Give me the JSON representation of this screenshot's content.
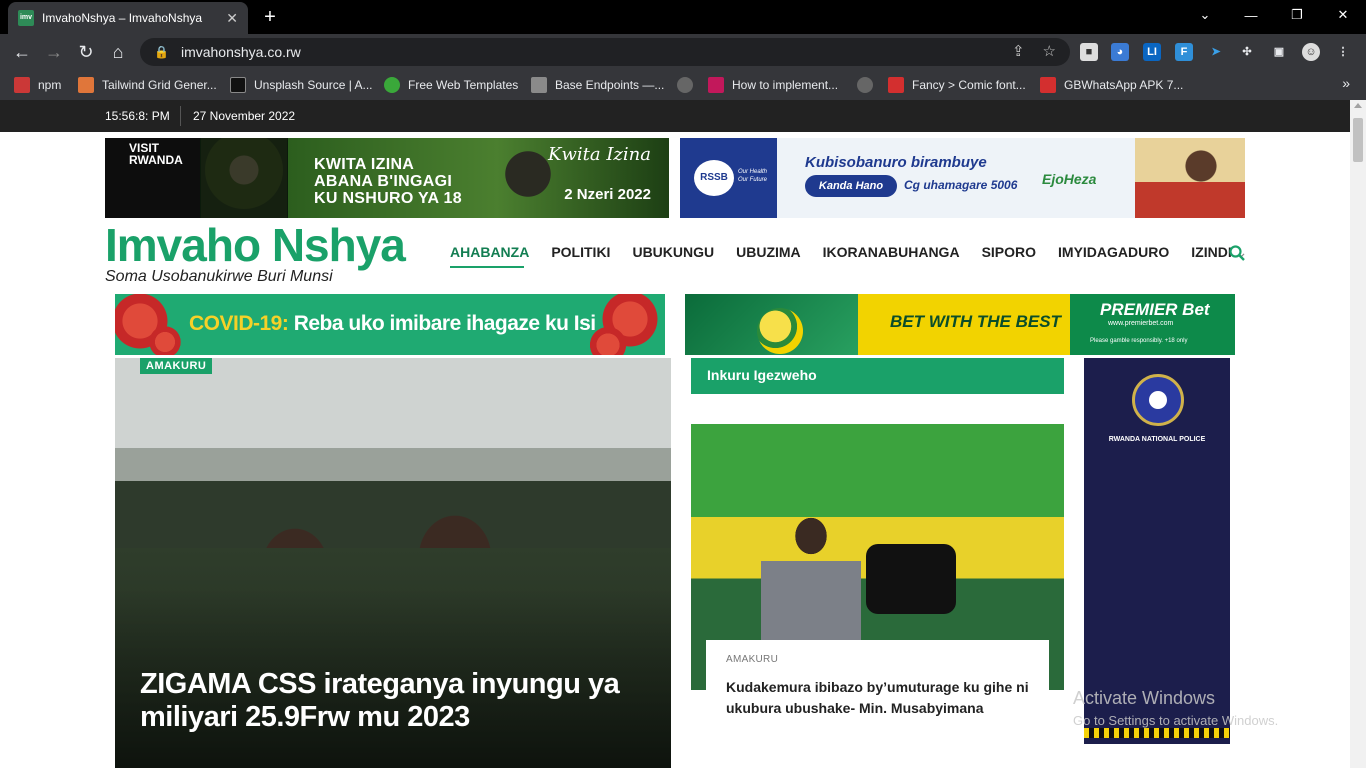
{
  "browser": {
    "tab_title": "ImvahoNshya – ImvahoNshya",
    "tab_close": "✕",
    "new_tab": "+",
    "url": "imvahonshya.co.rw",
    "window_controls": [
      "⌄",
      "—",
      "❐",
      "✕"
    ],
    "bookmarks": [
      {
        "label": "npm",
        "color": "#cb3837"
      },
      {
        "label": "Tailwind Grid Gener...",
        "color": "#e0763a"
      },
      {
        "label": "Unsplash Source | A...",
        "color": "#111111"
      },
      {
        "label": "Free Web Templates",
        "color": "#3aa83a"
      },
      {
        "label": "Base Endpoints —...",
        "color": "#8a8a8a"
      },
      {
        "label": "How to implement...",
        "color": "#c2185b"
      },
      {
        "label": "Fancy > Comic font...",
        "color": "#d32f2f"
      },
      {
        "label": "GBWhatsApp APK 7...",
        "color": "#d32f2f"
      }
    ],
    "bookmarks_more": "»"
  },
  "page": {
    "time": "15:56:8: PM",
    "date": "27 November 2022",
    "banner_left": {
      "visit": "VISIT RWANDA",
      "headline": "KWITA IZINA ABANA B'INGAGI KU NSHURO YA 18",
      "logo": "Kwita Izina",
      "date": "2 Nzeri 2022"
    },
    "banner_right": {
      "logo": "RSSB",
      "logo_sub": "Our Health Our Future",
      "headline": "Kubisobanuro birambuye",
      "pill": "Kanda Hano",
      "ussd": "Cg uhamagare 5006",
      "partner": "EjoHeza"
    },
    "site": {
      "logo": "Imvaho Nshya",
      "tagline": "Soma Usobanukirwe Buri Munsi"
    },
    "nav": [
      "AHABANZA",
      "POLITIKI",
      "UBUKUNGU",
      "UBUZIMA",
      "IKORANABUHANGA",
      "SIPORO",
      "IMYIDAGADURO",
      "IZINDI"
    ],
    "nav_more_icon": "⌄",
    "ad_covid": {
      "prefix": "COVID-19:",
      "text": " Reba uko imibare ihagaze ku Isi"
    },
    "ad_bet": {
      "slogan": "BET WITH THE BEST",
      "brand": "PREMIER Bet",
      "web": "www.premierbet.com",
      "resp": "Please gamble responsibly. +18 only"
    },
    "main_story": {
      "category": "AMAKURU",
      "headline": "ZIGAMA CSS irateganya inyungu ya miliyari 25.9Frw mu 2023"
    },
    "latest": {
      "heading": "Inkuru Igezweho",
      "category": "AMAKURU",
      "title": "Kudakemura ibibazo by’umuturage ku gihe ni ukubura ubushake- Min. Musabyimana"
    },
    "police_ad": {
      "label": "RWANDA NATIONAL POLICE"
    },
    "watermark": {
      "line1": "Activate Windows",
      "line2": "Go to Settings to activate Windows."
    }
  },
  "colors": {
    "brand_green": "#1aa169",
    "nav_active": "#137e52"
  }
}
